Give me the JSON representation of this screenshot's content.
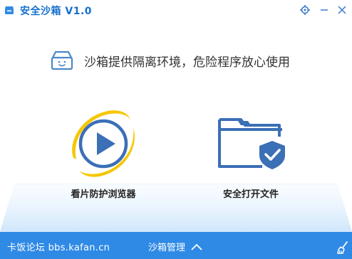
{
  "window": {
    "title": "安全沙箱 V1.0",
    "settings_icon": "target-gear-icon",
    "minimize_icon": "minimize-icon",
    "close_icon": "close-icon"
  },
  "slogan": {
    "text": "沙箱提供隔离环境，危险程序放心使用",
    "icon": "sandbox-box-icon"
  },
  "actions": [
    {
      "label": "看片防护浏览器",
      "icon": "play-browser-icon"
    },
    {
      "label": "安全打开文件",
      "icon": "shield-folder-icon"
    }
  ],
  "statusbar": {
    "forum": "卡饭论坛 bbs.kafan.cn",
    "manage": "沙箱管理",
    "manage_icon": "chevron-up-icon",
    "clean_icon": "broom-icon"
  },
  "colors": {
    "accent": "#2f8ae6",
    "title_blue": "#1570ce",
    "icon_blue": "#3b6fb6",
    "ring_gold": "#f6c600"
  }
}
